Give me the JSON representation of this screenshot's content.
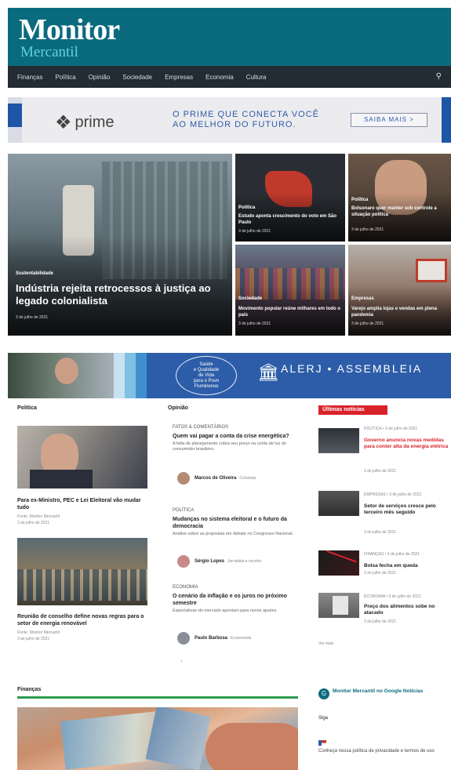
{
  "brand": {
    "line1": "Monitor",
    "line2": "Mercantil"
  },
  "nav": {
    "items": [
      "Finanças",
      "Política",
      "Opinião",
      "Sociedade",
      "Empresas",
      "Economia",
      "Cultura"
    ],
    "search_icon": "search-icon"
  },
  "ad_top": {
    "brand": "prime",
    "brand_icon": "bank-logo-icon",
    "tagline_1": "O PRIME QUE CONECTA VOCÊ",
    "tagline_2": "AO MELHOR DO FUTURO.",
    "cta": "SAIBA MAIS >"
  },
  "featured": {
    "main": {
      "category": "Sustentabilidade",
      "title": "Indústria rejeita retrocessos à justiça ao legado colonialista",
      "date": "3 de julho de 2021"
    },
    "f1": {
      "category": "Política",
      "title": "Estudo aponta crescimento do voto em São Paulo",
      "date": "3 de julho de 2021"
    },
    "f2": {
      "category": "Política",
      "title": "Bolsonaro quer manter sob controle a situação política",
      "date": "3 de julho de 2021"
    },
    "f3": {
      "category": "Sociedade",
      "title": "Movimento popular reúne milhares em todo o país",
      "date": "3 de julho de 2021"
    },
    "f4": {
      "category": "Empresas",
      "title": "Varejo amplia lojas e vendas em plena pandemia",
      "date": "3 de julho de 2021"
    }
  },
  "ad_mid": {
    "circle_text": [
      "Saúde",
      "e Qualidade",
      "de Vida",
      "para o Povo",
      "Fluminense"
    ],
    "org": "ALERJ • ASSEMBLEIA"
  },
  "columns": {
    "left_header": "Política",
    "mid_header": "Opinião",
    "live_header": "Últimas notícias"
  },
  "left_col": [
    {
      "title": "Para ex-Ministro, PEC e Lei Eleitoral vão mudar tudo",
      "sub": "Fonte: Monitor Mercantil",
      "date": "3 de julho de 2021"
    },
    {
      "title": "Reunião de conselho define novas regras para o setor de energia renovável",
      "sub": "Fonte: Monitor Mercantil",
      "date": "3 de julho de 2021"
    }
  ],
  "opinion": [
    {
      "category": "FATOS & COMENTÁRIOS",
      "title": "Quem vai pagar a conta da crise energética?",
      "sub": "A falta de planejamento cobra seu preço na conta de luz do consumidor brasileiro.",
      "author": "Marcos de Oliveira",
      "role": "Colunista"
    },
    {
      "category": "POLÍTICA",
      "title": "Mudanças no sistema eleitoral e o futuro da democracia",
      "sub": "Análise sobre as propostas em debate no Congresso Nacional.",
      "author": "Sérgio Lopes",
      "role": "Jornalista e escritor"
    },
    {
      "category": "ECONOMIA",
      "title": "O cenário da inflação e os juros no próximo semestre",
      "sub": "Expectativas do mercado apontam para novos ajustes.",
      "author": "Paulo Barbosa",
      "role": "Economista"
    }
  ],
  "live": [
    {
      "meta": "POLÍTICA • 3 de julho de 2021",
      "title": "Governo anuncia novas medidas para conter alta da energia elétrica",
      "date": "3 de julho de 2021"
    },
    {
      "meta": "EMPRESAS • 3 de julho de 2021",
      "title": "Setor de serviços cresce pelo terceiro mês seguido",
      "date": "3 de julho de 2021"
    },
    {
      "meta": "FINANÇAS • 3 de julho de 2021",
      "title": "Bolsa fecha em queda",
      "date": "3 de julho de 2021"
    },
    {
      "meta": "ECONOMIA • 3 de julho de 2021",
      "title": "Preço dos alimentos sobe no atacado",
      "date": "3 de julho de 2021"
    }
  ],
  "live_more": "Ver mais",
  "bottom": {
    "left_header": "Finanças",
    "side_title": "Monitor Mercantil no Google Notícias",
    "side_label": "Siga",
    "side_text": "Conheça nossa política de privacidade e termos de uso"
  }
}
